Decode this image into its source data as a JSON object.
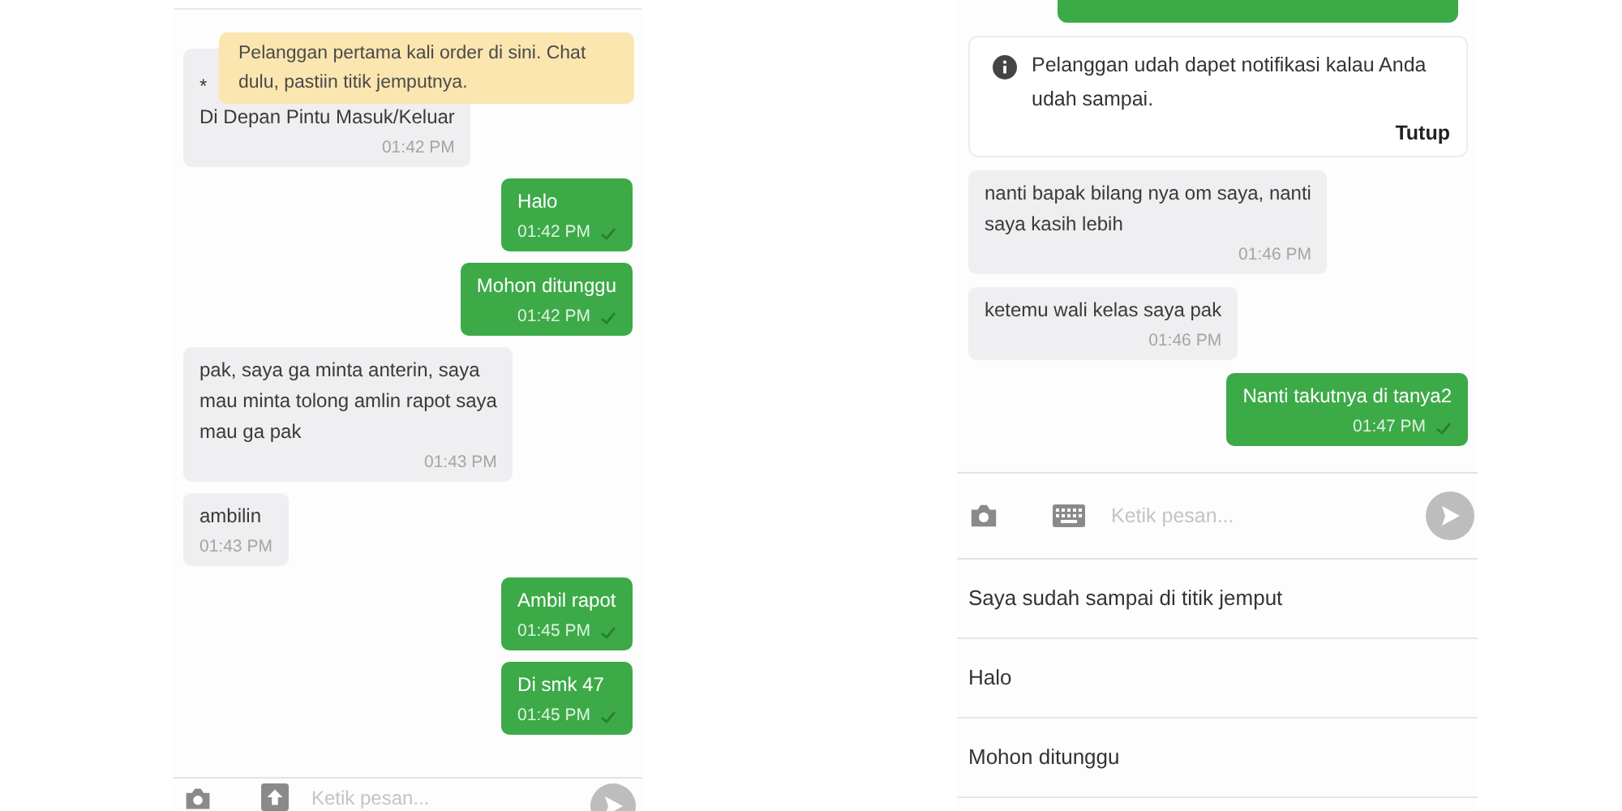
{
  "left_chat": {
    "tooltip": "Pelanggan pertama kali order di sini. Chat dulu, pastiin titik jemputnya.",
    "messages": [
      {
        "kind": "incoming",
        "lines": [
          "*",
          "Di Depan Pintu Masuk/Keluar"
        ],
        "time": "01:42 PM"
      },
      {
        "kind": "outgoing",
        "lines": [
          "Halo"
        ],
        "time": "01:42 PM"
      },
      {
        "kind": "outgoing",
        "lines": [
          "Mohon ditunggu"
        ],
        "time": "01:42 PM"
      },
      {
        "kind": "incoming",
        "lines": [
          "pak, saya ga minta anterin, saya",
          "mau minta tolong amlin rapot saya",
          "mau ga pak"
        ],
        "time": "01:43 PM"
      },
      {
        "kind": "incoming",
        "lines": [
          "ambilin"
        ],
        "time": "01:43 PM"
      },
      {
        "kind": "outgoing",
        "lines": [
          "Ambil rapot"
        ],
        "time": "01:45 PM"
      },
      {
        "kind": "outgoing",
        "lines": [
          "Di smk 47"
        ],
        "time": "01:45 PM"
      }
    ],
    "input": {
      "placeholder": "Ketik pesan..."
    }
  },
  "right_chat": {
    "notice": {
      "text": "Pelanggan udah dapet notifikasi kalau Anda udah sampai.",
      "close": "Tutup"
    },
    "messages": [
      {
        "kind": "incoming",
        "lines": [
          "nanti bapak bilang nya om saya, nanti",
          "saya kasih lebih"
        ],
        "time": "01:46 PM"
      },
      {
        "kind": "incoming",
        "lines": [
          "ketemu wali kelas saya pak"
        ],
        "time": "01:46 PM"
      },
      {
        "kind": "outgoing",
        "lines": [
          "Nanti takutnya di tanya2"
        ],
        "time": "01:47 PM"
      }
    ],
    "input": {
      "placeholder": "Ketik pesan..."
    },
    "quick_replies": [
      "Saya sudah sampai di titik jemput",
      "Halo",
      "Mohon ditunggu"
    ]
  }
}
